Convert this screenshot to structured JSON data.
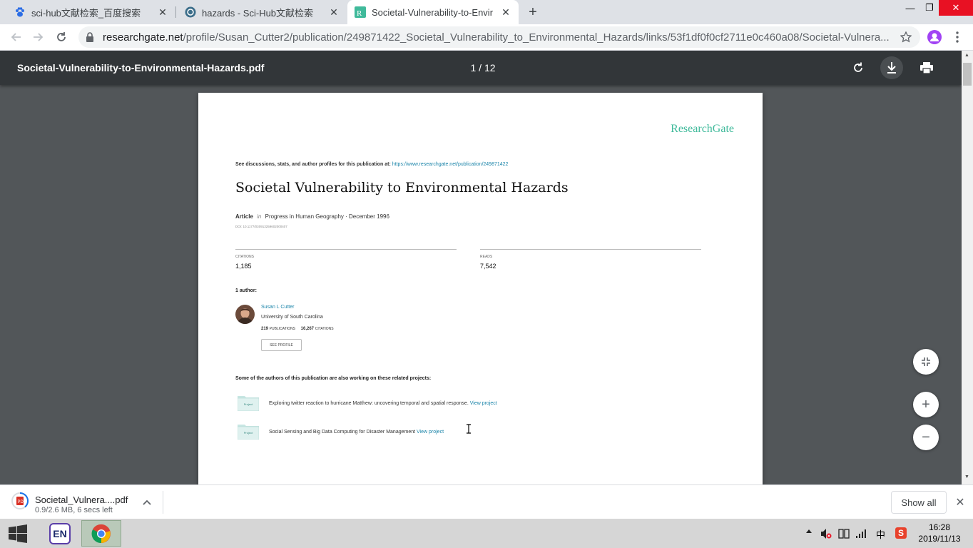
{
  "browser": {
    "tabs": [
      {
        "title": "sci-hub文献检索_百度搜索",
        "icon": "baidu-paw-icon",
        "close": "✕"
      },
      {
        "title": "hazards - Sci-Hub文献检索",
        "icon": "scihub-icon",
        "close": "✕"
      },
      {
        "title": "Societal-Vulnerability-to-Envir",
        "icon": "researchgate-icon",
        "close": "✕",
        "active": true
      }
    ],
    "new_tab": "+",
    "window_controls": {
      "minimize": "—",
      "restore": "❐",
      "close": "✕"
    },
    "address": {
      "host": "researchgate.net",
      "path": "/profile/Susan_Cutter2/publication/249871422_Societal_Vulnerability_to_Environmental_Hazards/links/53f1df0f0cf2711e0c460a08/Societal-Vulnera..."
    }
  },
  "pdf_viewer": {
    "filename": "Societal-Vulnerability-to-Environmental-Hazards.pdf",
    "page_indicator": "1 / 12"
  },
  "document": {
    "brand": "ResearchGate",
    "discussion_prefix": "See discussions, stats, and author profiles for this publication at: ",
    "discussion_link": "https://www.researchgate.net/publication/249871422",
    "title": "Societal Vulnerability to Environmental Hazards",
    "article_label": "Article",
    "in_label": "in",
    "journal": "Progress in Human Geography · December 1996",
    "doi": "DOI: 10.1177/030913259602000407",
    "citations_label": "CITATIONS",
    "citations_value": "1,185",
    "reads_label": "READS",
    "reads_value": "7,542",
    "authors_heading": "1 author:",
    "author": {
      "name": "Susan L Cutter",
      "affiliation": "University of South Carolina",
      "publications_count": "219",
      "publications_label": "PUBLICATIONS",
      "citations_count": "16,267",
      "citations_label": "CITATIONS",
      "profile_button": "SEE PROFILE"
    },
    "related_heading": "Some of the authors of this publication are also working on these related projects:",
    "projects": [
      {
        "badge": "Project",
        "text": "Exploring twitter reaction to hurricane Matthew: uncovering temporal and spatial response.",
        "link": "View project"
      },
      {
        "badge": "Project",
        "text": "Social Sensing and Big Data Computing for Disaster Management",
        "link": "View project"
      }
    ]
  },
  "zoom": {
    "fit": "⤡",
    "in": "+",
    "out": "−"
  },
  "download_shelf": {
    "file_name": "Societal_Vulnera....pdf",
    "status": "0.9/2.6 MB, 6 secs left",
    "show_all": "Show all",
    "close": "✕"
  },
  "taskbar": {
    "ime": "EN",
    "tray_lang": "中",
    "tray_sogou": "S",
    "time": "16:28",
    "date": "2019/11/13"
  },
  "colors": {
    "researchgate_teal": "#40ba9b",
    "link_blue": "#1a84a9",
    "pdf_toolbar": "#323639",
    "viewer_bg": "#525659"
  }
}
